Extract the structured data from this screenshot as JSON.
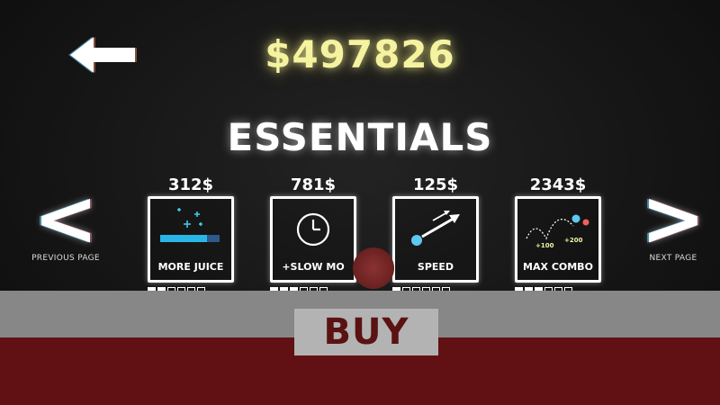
{
  "header": {
    "money": "$497826",
    "back_icon": "left-arrow-icon"
  },
  "section": {
    "title": "ESSENTIALS"
  },
  "navigation": {
    "prev": {
      "glyph": "<",
      "label": "PREVIOUS PAGE"
    },
    "next": {
      "glyph": ">",
      "label": "NEXT PAGE"
    }
  },
  "items": [
    {
      "price": "312$",
      "name": "MORE JUICE",
      "icon": "juice-sparkle-icon",
      "level": 2,
      "max_level": 6
    },
    {
      "price": "781$",
      "name": "+SLOW MO",
      "icon": "clock-icon",
      "level": 3,
      "max_level": 6
    },
    {
      "price": "125$",
      "name": "SPEED",
      "icon": "speed-arrows-icon",
      "level": 1,
      "max_level": 6
    },
    {
      "price": "2343$",
      "name": "MAX COMBO",
      "icon": "combo-bounce-icon",
      "level": 3,
      "max_level": 6
    }
  ],
  "combo_icon_labels": [
    "+100",
    "+200"
  ],
  "buy": {
    "label": "BUY"
  },
  "colors": {
    "money": "#f5f3a0",
    "juice_bar": "#29b6e6",
    "floor_gray": "#878787",
    "floor_red": "#611114",
    "buy_text": "#5a1213"
  }
}
